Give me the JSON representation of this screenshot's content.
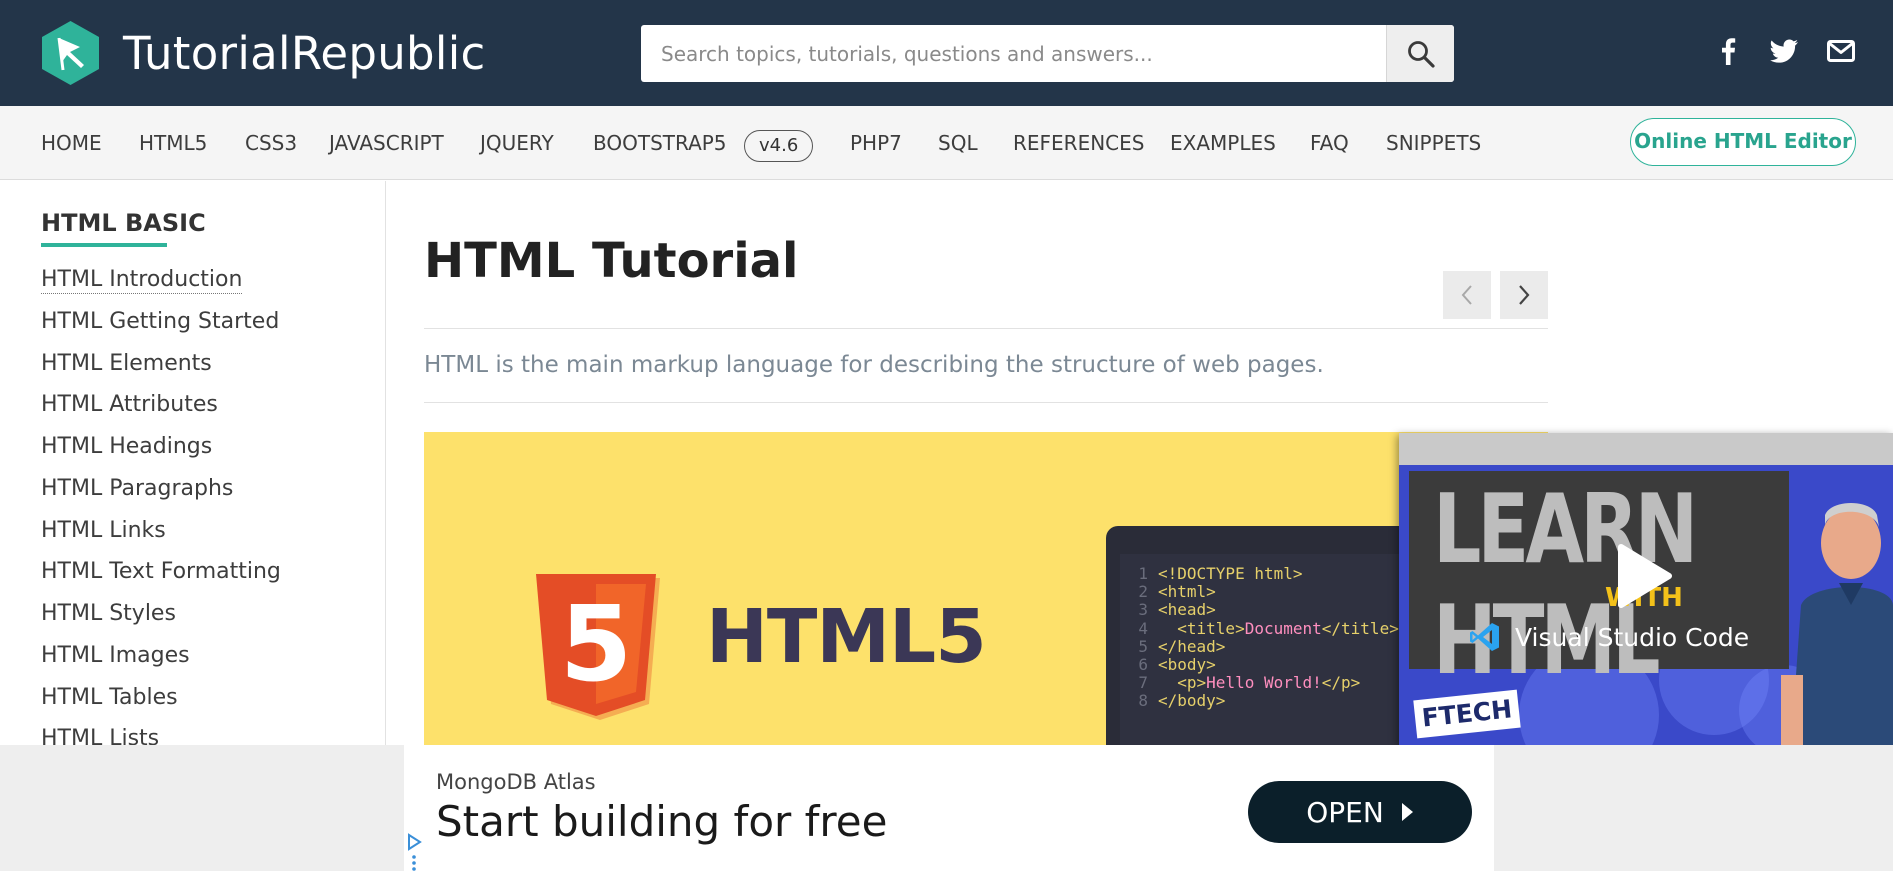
{
  "header": {
    "brand": "TutorialRepublic",
    "search_placeholder": "Search topics, tutorials, questions and answers...",
    "social": [
      "facebook-icon",
      "twitter-icon",
      "mail-icon"
    ]
  },
  "nav": {
    "items": [
      "HOME",
      "HTML5",
      "CSS3",
      "JAVASCRIPT",
      "JQUERY",
      "BOOTSTRAP5",
      "PHP7",
      "SQL",
      "REFERENCES",
      "EXAMPLES",
      "FAQ",
      "SNIPPETS"
    ],
    "version_badge": "v4.6",
    "editor_button": "Online HTML Editor"
  },
  "sidebar": {
    "heading": "HTML BASIC",
    "items": [
      "HTML Introduction",
      "HTML Getting Started",
      "HTML Elements",
      "HTML Attributes",
      "HTML Headings",
      "HTML Paragraphs",
      "HTML Links",
      "HTML Text Formatting",
      "HTML Styles",
      "HTML Images",
      "HTML Tables",
      "HTML Lists"
    ]
  },
  "main": {
    "title": "HTML Tutorial",
    "lead": "HTML is the main markup language for describing the structure of web pages."
  },
  "banner": {
    "badge_digit": "5",
    "label": "HTML5",
    "code_lines": [
      {
        "num": "1",
        "indent": "",
        "parts": [
          {
            "t": "<!DOCTYPE html>",
            "c": "tag"
          }
        ]
      },
      {
        "num": "2",
        "indent": "",
        "parts": [
          {
            "t": "<html>",
            "c": "tag"
          }
        ]
      },
      {
        "num": "3",
        "indent": "",
        "parts": [
          {
            "t": "<head>",
            "c": "tag"
          }
        ]
      },
      {
        "num": "4",
        "indent": "  ",
        "parts": [
          {
            "t": "<title>",
            "c": "tag"
          },
          {
            "t": "Document",
            "c": "txt"
          },
          {
            "t": "</title>",
            "c": "tag"
          }
        ]
      },
      {
        "num": "5",
        "indent": "",
        "parts": [
          {
            "t": "</head>",
            "c": "tag"
          }
        ]
      },
      {
        "num": "6",
        "indent": "",
        "parts": [
          {
            "t": "<body>",
            "c": "tag"
          }
        ]
      },
      {
        "num": "7",
        "indent": "  ",
        "parts": [
          {
            "t": "<p>",
            "c": "tag"
          },
          {
            "t": "Hello World!",
            "c": "txt"
          },
          {
            "t": "</p>",
            "c": "tag"
          }
        ]
      },
      {
        "num": "8",
        "indent": "",
        "parts": [
          {
            "t": "</body>",
            "c": "tag"
          }
        ]
      }
    ]
  },
  "video": {
    "title": "LEARN HTML",
    "with_text": "WITH",
    "product": "Visual Studio Code",
    "channel": "FTECH"
  },
  "ad": {
    "sponsor": "MongoDB Atlas",
    "headline": "Start building for free",
    "cta": "OPEN"
  },
  "colors": {
    "header_bg": "#233549",
    "accent": "#2fb39a",
    "banner_bg": "#fde16b",
    "html5_orange": "#e44d26",
    "html5_text": "#3b3756"
  }
}
